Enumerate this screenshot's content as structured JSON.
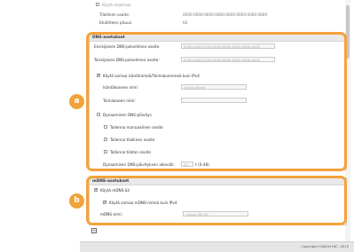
{
  "top": {
    "partial_checkbox_label": "Käytä ohjelmaa",
    "link_local_label": "Tilallinen osoite:",
    "link_local_value": "0000:0000:0000:0000:0000:0000:0000:0000",
    "prefix_label": "Etuliitteen pituus:",
    "prefix_value": "64"
  },
  "dns": {
    "title": "DNS-asetukset",
    "primary_label": "Ensisijaisen DNS-palvelimen osoite:",
    "primary_value": "0000:0000:0000:0000:0000:0000:0000:0000",
    "secondary_label": "Toissijaisen DNS-palvelimen osoite:",
    "secondary_value": "0000:0000:0000:0000:0000:0000:0000:0000",
    "same_host_label": "Käytä samaa isäntänimeä/Toimialuenimeä kuin IPv4",
    "same_host_checked": true,
    "host_name_label": "Isäntäkoneen nimi:",
    "host_name_value": "Canon Name",
    "domain_label": "Toimialueen nimi:",
    "domain_value": "",
    "dynamic_label": "Dynaaminen DNS-päivitys",
    "dynamic_checked": false,
    "manual_label": "Tallenna manuaalinen osoite",
    "stateful_label": "Tallenna tilallinen osoite",
    "stateless_label": "Tallenna tilaton osoite",
    "interval_label": "Dynaamisen DNS-päivityksen aikaväli:",
    "interval_value": "24",
    "interval_unit": "t (0-48)"
  },
  "mdns": {
    "title": "mDNS-asetukset",
    "use_label": "Käytä mDNS:ää",
    "use_checked": true,
    "same_label": "Käytä samaa mDNS-nimeä kuin IPv4",
    "same_checked": true,
    "name_label": "mDNS-nimi:",
    "name_value": "Canon ZM-PU"
  },
  "callouts": {
    "a": "a",
    "b": "b"
  },
  "bottom_icon": "≡",
  "footer": {
    "copyright": "Copyright CANON INC. 2015"
  }
}
